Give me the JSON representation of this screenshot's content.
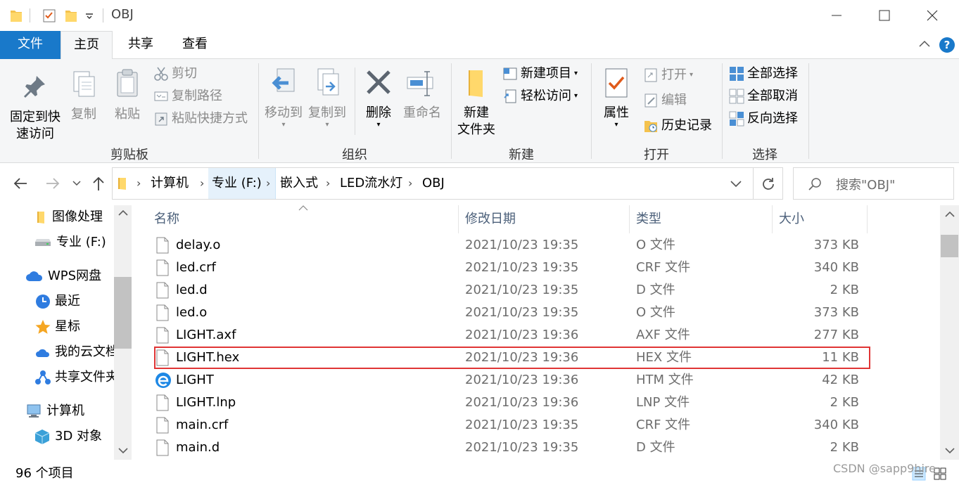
{
  "window": {
    "title": "OBJ",
    "minimize_icon": "minimize-icon",
    "maximize_icon": "maximize-icon",
    "close_icon": "close-icon"
  },
  "ribbon_tabs": {
    "file": "文件",
    "home": "主页",
    "share": "共享",
    "view": "查看"
  },
  "ribbon": {
    "clipboard": {
      "label": "剪贴板",
      "pin": "固定到快速访问",
      "pin_line1": "固定到快",
      "pin_line2": "速访问",
      "copy": "复制",
      "paste": "粘贴",
      "cut": "剪切",
      "copy_path": "复制路径",
      "paste_shortcut": "粘贴快捷方式"
    },
    "organize": {
      "label": "组织",
      "move_to": "移动到",
      "copy_to": "复制到",
      "delete": "删除",
      "rename": "重命名"
    },
    "new": {
      "label": "新建",
      "new_folder_line1": "新建",
      "new_folder_line2": "文件夹",
      "new_item": "新建项目",
      "easy_access": "轻松访问"
    },
    "open": {
      "label": "打开",
      "properties": "属性",
      "open": "打开",
      "edit": "编辑",
      "history": "历史记录"
    },
    "select": {
      "label": "选择",
      "select_all": "全部选择",
      "select_none": "全部取消",
      "invert": "反向选择"
    }
  },
  "address": {
    "crumbs": [
      "计算机",
      "专业 (F:)",
      "嵌入式",
      "LED流水灯",
      "OBJ"
    ],
    "search_placeholder": "搜索\"OBJ\""
  },
  "nav": {
    "items": [
      {
        "label": "图像处理",
        "icon": "folder-icon"
      },
      {
        "label": "专业 (F:)",
        "icon": "drive-icon"
      },
      {
        "label": "WPS网盘",
        "icon": "cloud-icon"
      },
      {
        "label": "最近",
        "icon": "clock-icon"
      },
      {
        "label": "星标",
        "icon": "star-icon"
      },
      {
        "label": "我的云文档",
        "icon": "cloud-doc-icon"
      },
      {
        "label": "共享文件夹",
        "icon": "share-icon"
      },
      {
        "label": "计算机",
        "icon": "computer-icon"
      },
      {
        "label": "3D 对象",
        "icon": "cube-icon"
      }
    ]
  },
  "columns": {
    "name": "名称",
    "date": "修改日期",
    "type": "类型",
    "size": "大小"
  },
  "files": [
    {
      "name": "delay.o",
      "date": "2021/10/23 19:35",
      "type": "O 文件",
      "size": "373 KB",
      "icon": "file-icon"
    },
    {
      "name": "led.crf",
      "date": "2021/10/23 19:35",
      "type": "CRF 文件",
      "size": "340 KB",
      "icon": "file-icon"
    },
    {
      "name": "led.d",
      "date": "2021/10/23 19:35",
      "type": "D 文件",
      "size": "2 KB",
      "icon": "file-icon"
    },
    {
      "name": "led.o",
      "date": "2021/10/23 19:35",
      "type": "O 文件",
      "size": "373 KB",
      "icon": "file-icon"
    },
    {
      "name": "LIGHT.axf",
      "date": "2021/10/23 19:36",
      "type": "AXF 文件",
      "size": "277 KB",
      "icon": "file-icon"
    },
    {
      "name": "LIGHT.hex",
      "date": "2021/10/23 19:36",
      "type": "HEX 文件",
      "size": "11 KB",
      "icon": "file-icon"
    },
    {
      "name": "LIGHT",
      "date": "2021/10/23 19:36",
      "type": "HTM 文件",
      "size": "42 KB",
      "icon": "browser-icon"
    },
    {
      "name": "LIGHT.lnp",
      "date": "2021/10/23 19:36",
      "type": "LNP 文件",
      "size": "2 KB",
      "icon": "file-icon"
    },
    {
      "name": "main.crf",
      "date": "2021/10/23 19:35",
      "type": "CRF 文件",
      "size": "340 KB",
      "icon": "file-icon"
    },
    {
      "name": "main.d",
      "date": "2021/10/23 19:35",
      "type": "D 文件",
      "size": "2 KB",
      "icon": "file-icon"
    }
  ],
  "status": {
    "count": "96 个项目"
  },
  "watermark": "CSDN @sapp9hire",
  "colors": {
    "accent": "#1979ca",
    "highlight_border": "#e03535",
    "ribbon_bg": "#f5f6f7"
  }
}
